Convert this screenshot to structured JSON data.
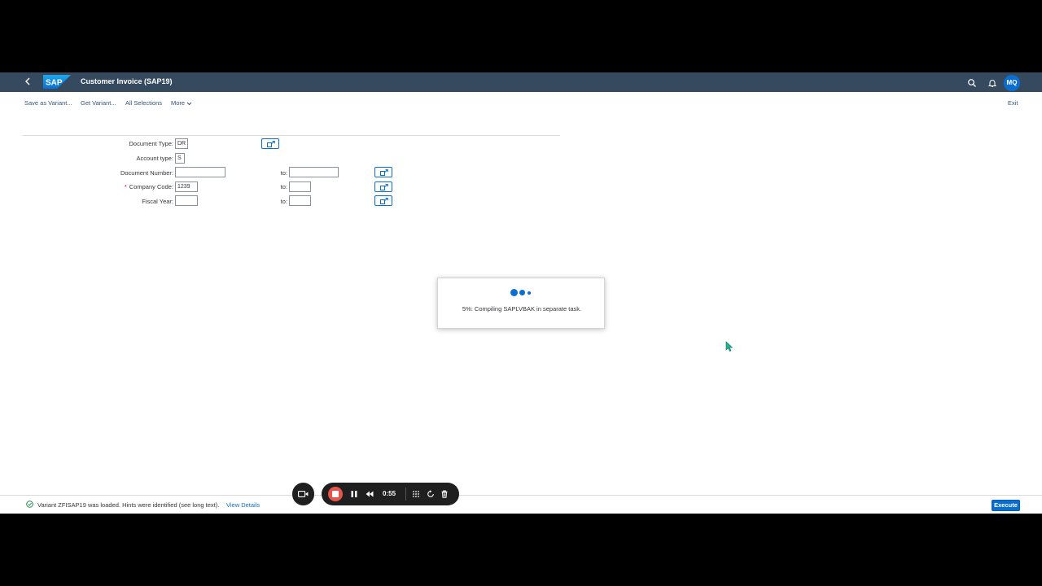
{
  "shell": {
    "title": "Customer Invoice (SAP19)",
    "logo_text": "SAP",
    "avatar_initials": "MQ"
  },
  "toolbar": {
    "save_variant": "Save as Variant...",
    "get_variant": "Get Variant...",
    "all_selections": "All Selections",
    "more": "More",
    "exit": "Exit"
  },
  "form": {
    "document_type": {
      "label": "Document Type:",
      "value": "DR"
    },
    "account_type": {
      "label": "Account type:",
      "value": "S"
    },
    "document_number": {
      "label": "Document Number:",
      "from": "",
      "to_label": "to:",
      "to": ""
    },
    "company_code": {
      "required_mark": "*",
      "label": "Company Code:",
      "from": "1239",
      "to_label": "to:",
      "to": ""
    },
    "fiscal_year": {
      "label": "Fiscal Year:",
      "from": "",
      "to_label": "to:",
      "to": ""
    }
  },
  "busy_dialog": {
    "message": "5%: Compiling SAPLVBAK in separate task."
  },
  "footer": {
    "message": "Variant ZFISAP19 was loaded. Hints were identified (see long text).",
    "view_details": "View Details",
    "execute": "Execute"
  },
  "recorder": {
    "time": "0:55"
  },
  "colors": {
    "shell_bg": "#354a5f",
    "accent": "#0a6ed1",
    "stop": "#e8544a"
  }
}
